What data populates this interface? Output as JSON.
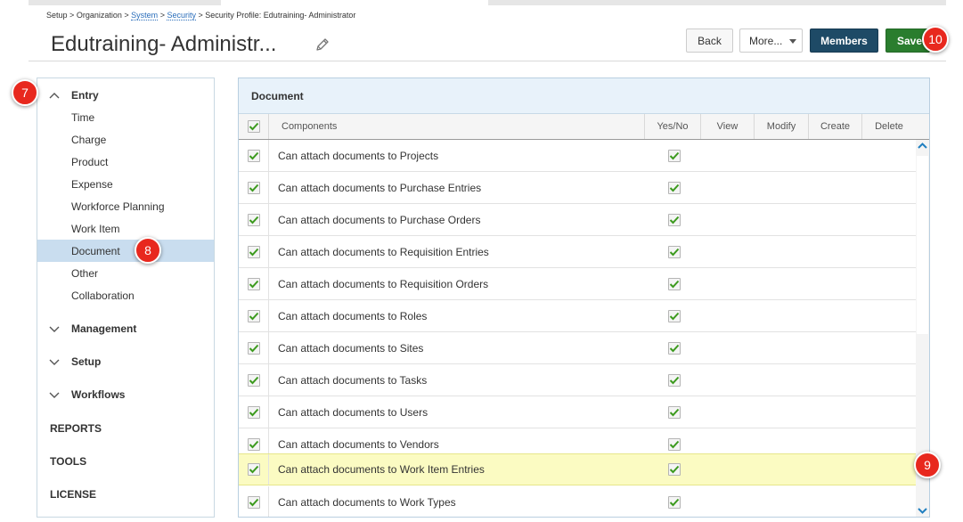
{
  "breadcrumb": {
    "setup": "Setup",
    "sep": ">",
    "organization": "Organization",
    "system": "System",
    "security": "Security",
    "current": "Security Profile: Edutraining- Administrator"
  },
  "page_title": "Edutraining- Administr...",
  "toolbar": {
    "back_label": "Back",
    "more_label": "More...",
    "members_label": "Members",
    "save_label": "Save"
  },
  "callouts": {
    "c7": "7",
    "c8": "8",
    "c9": "9",
    "c10": "10"
  },
  "sidebar": {
    "entry": {
      "label": "Entry",
      "items": [
        {
          "label": "Time"
        },
        {
          "label": "Charge"
        },
        {
          "label": "Product"
        },
        {
          "label": "Expense"
        },
        {
          "label": "Workforce Planning"
        },
        {
          "label": "Work Item"
        },
        {
          "label": "Document"
        },
        {
          "label": "Other"
        },
        {
          "label": "Collaboration"
        }
      ],
      "active": "Document"
    },
    "management": "Management",
    "setup": "Setup",
    "workflows": "Workflows",
    "reports": "REPORTS",
    "tools": "TOOLS",
    "license": "LICENSE"
  },
  "panel": {
    "title": "Document",
    "columns": {
      "components": "Components",
      "yesno": "Yes/No",
      "view": "View",
      "modify": "Modify",
      "create": "Create",
      "delete": "Delete"
    },
    "rows": [
      {
        "label": "Can attach documents to Projects"
      },
      {
        "label": "Can attach documents to Purchase Entries"
      },
      {
        "label": "Can attach documents to Purchase Orders"
      },
      {
        "label": "Can attach documents to Requisition Entries"
      },
      {
        "label": "Can attach documents to Requisition Orders"
      },
      {
        "label": "Can attach documents to Roles"
      },
      {
        "label": "Can attach documents to Sites"
      },
      {
        "label": "Can attach documents to Tasks"
      },
      {
        "label": "Can attach documents to Users"
      },
      {
        "label": "Can attach documents to Vendors"
      },
      {
        "label": "Can attach documents to Work Item Entries"
      },
      {
        "label": "Can attach documents to Work Types"
      }
    ],
    "highlighted_row": "Can attach documents to Work Item Entries"
  },
  "colors": {
    "members_button": "#1e4a66",
    "save_button": "#2a7d2e",
    "callout": "#e8281e",
    "active_sidebar": "#c9ddef",
    "highlight_row": "#fbfbc2",
    "check_green": "#3c9a1e"
  }
}
